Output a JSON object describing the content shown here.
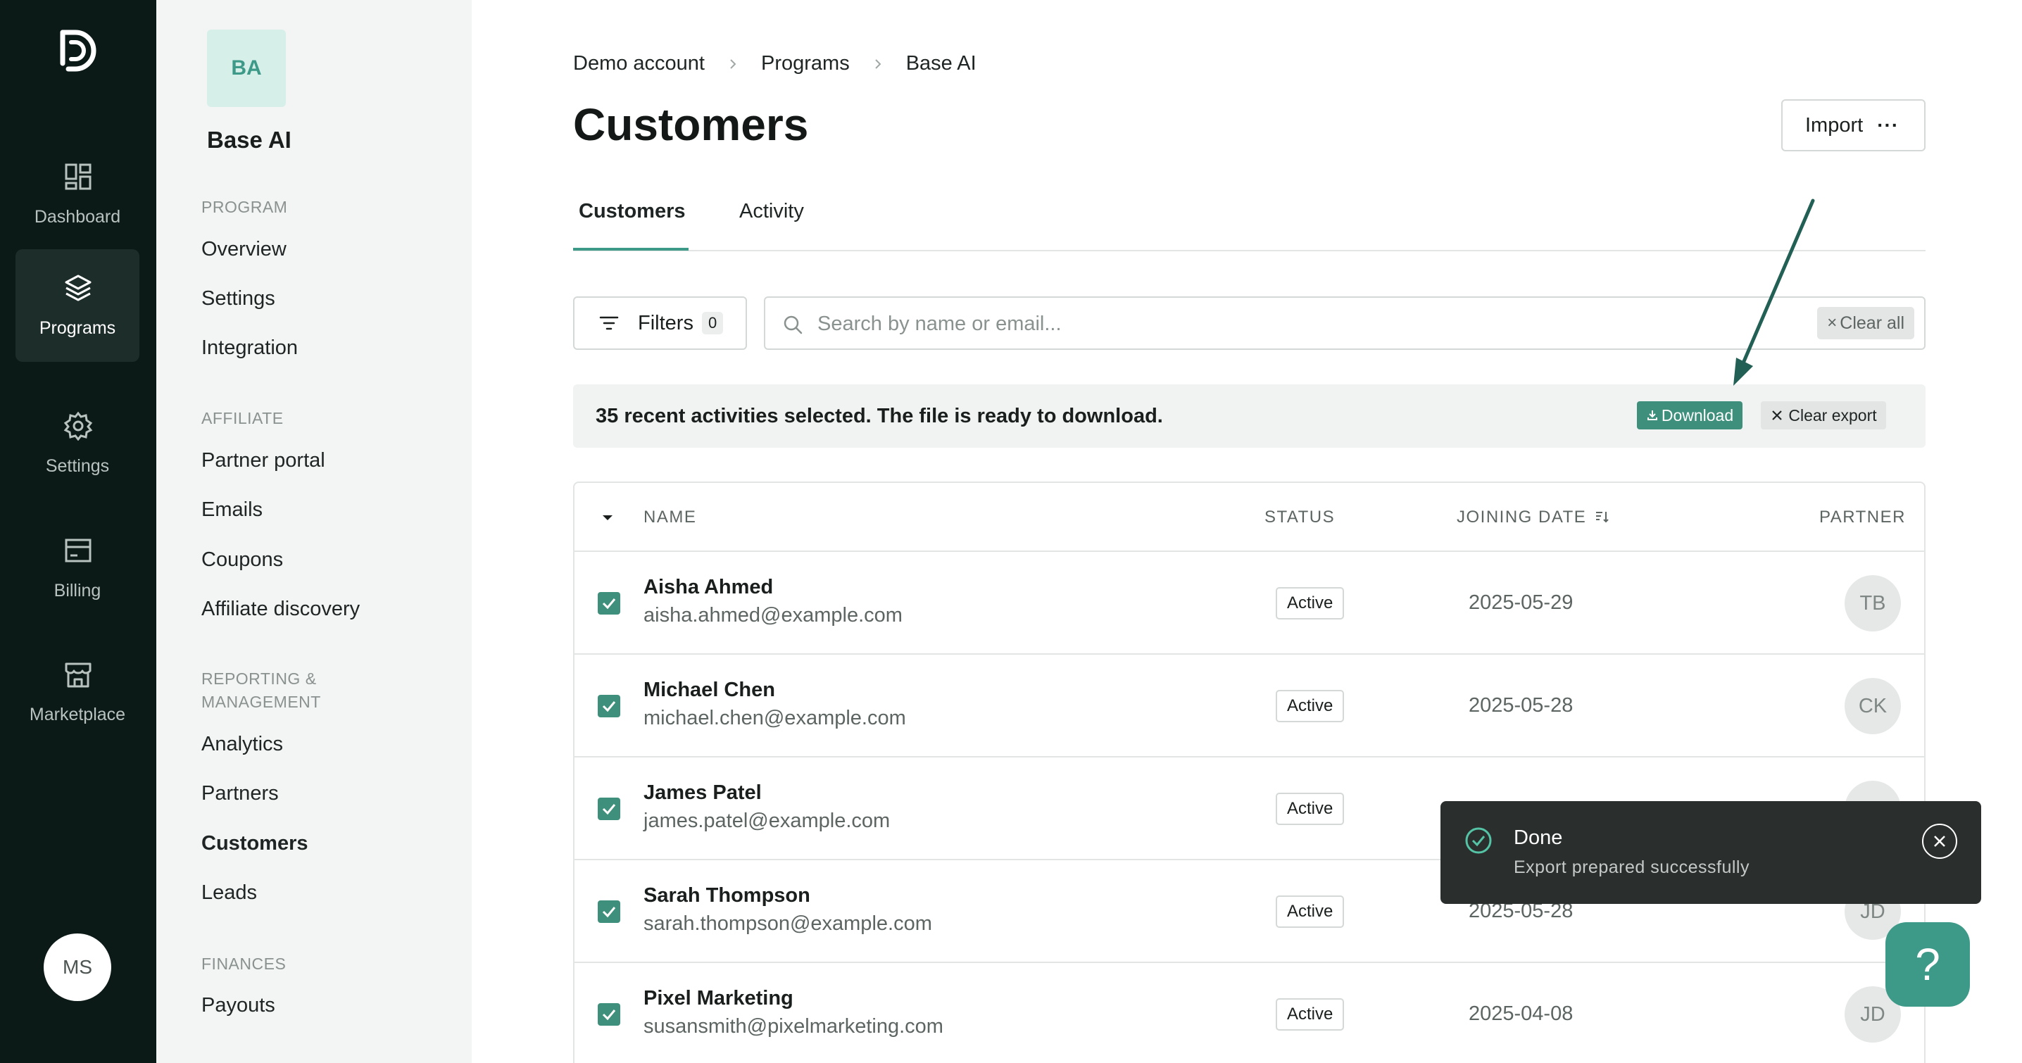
{
  "rail": {
    "logo_icon": "brand-logo-icon",
    "items": [
      {
        "label": "Dashboard",
        "icon": "dashboard-grid-icon"
      },
      {
        "label": "Programs",
        "icon": "layers-icon",
        "active": true
      },
      {
        "label": "Settings",
        "icon": "gear-icon"
      },
      {
        "label": "Billing",
        "icon": "billing-card-icon"
      },
      {
        "label": "Marketplace",
        "icon": "store-icon"
      }
    ],
    "avatar": "MS"
  },
  "sidebar": {
    "program_badge": "BA",
    "program_name": "Base AI",
    "sections": [
      {
        "heading": "PROGRAM",
        "items": [
          "Overview",
          "Settings",
          "Integration"
        ]
      },
      {
        "heading": "AFFILIATE",
        "items": [
          "Partner portal",
          "Emails",
          "Coupons",
          "Affiliate discovery"
        ]
      },
      {
        "heading": "REPORTING & MANAGEMENT",
        "items": [
          "Analytics",
          "Partners",
          "Customers",
          "Leads"
        ]
      },
      {
        "heading": "FINANCES",
        "items": [
          "Payouts"
        ]
      }
    ],
    "active_item": "Customers"
  },
  "breadcrumb": [
    "Demo account",
    "Programs",
    "Base AI"
  ],
  "page_title": "Customers",
  "import_button": "Import",
  "tabs": [
    {
      "label": "Customers",
      "active": true
    },
    {
      "label": "Activity",
      "active": false
    }
  ],
  "filters": {
    "label": "Filters",
    "count": "0"
  },
  "search": {
    "placeholder": "Search by name or email...",
    "clear_label": "Clear all"
  },
  "notice": {
    "text": "35 recent activities selected. The file is ready to download.",
    "download_label": "Download",
    "clear_label": "Clear export"
  },
  "table": {
    "columns": [
      "NAME",
      "STATUS",
      "JOINING DATE",
      "PARTNER"
    ],
    "rows": [
      {
        "name": "Aisha Ahmed",
        "email": "aisha.ahmed@example.com",
        "status": "Active",
        "date": "2025-05-29",
        "partner": "TB",
        "checked": true
      },
      {
        "name": "Michael Chen",
        "email": "michael.chen@example.com",
        "status": "Active",
        "date": "2025-05-28",
        "partner": "CK",
        "checked": true
      },
      {
        "name": "James Patel",
        "email": "james.patel@example.com",
        "status": "Active",
        "date": "",
        "partner": "",
        "checked": true
      },
      {
        "name": "Sarah Thompson",
        "email": "sarah.thompson@example.com",
        "status": "Active",
        "date": "2025-05-28",
        "partner": "JD",
        "checked": true
      },
      {
        "name": "Pixel Marketing",
        "email": "susansmith@pixelmarketing.com",
        "status": "Active",
        "date": "2025-04-08",
        "partner": "JD",
        "checked": true
      }
    ]
  },
  "toast": {
    "title": "Done",
    "message": "Export prepared successfully"
  },
  "help_button": "?",
  "colors": {
    "rail_bg": "#0b1a17",
    "accent": "#3e8f7b",
    "toast_bg": "#2a2f2e"
  }
}
